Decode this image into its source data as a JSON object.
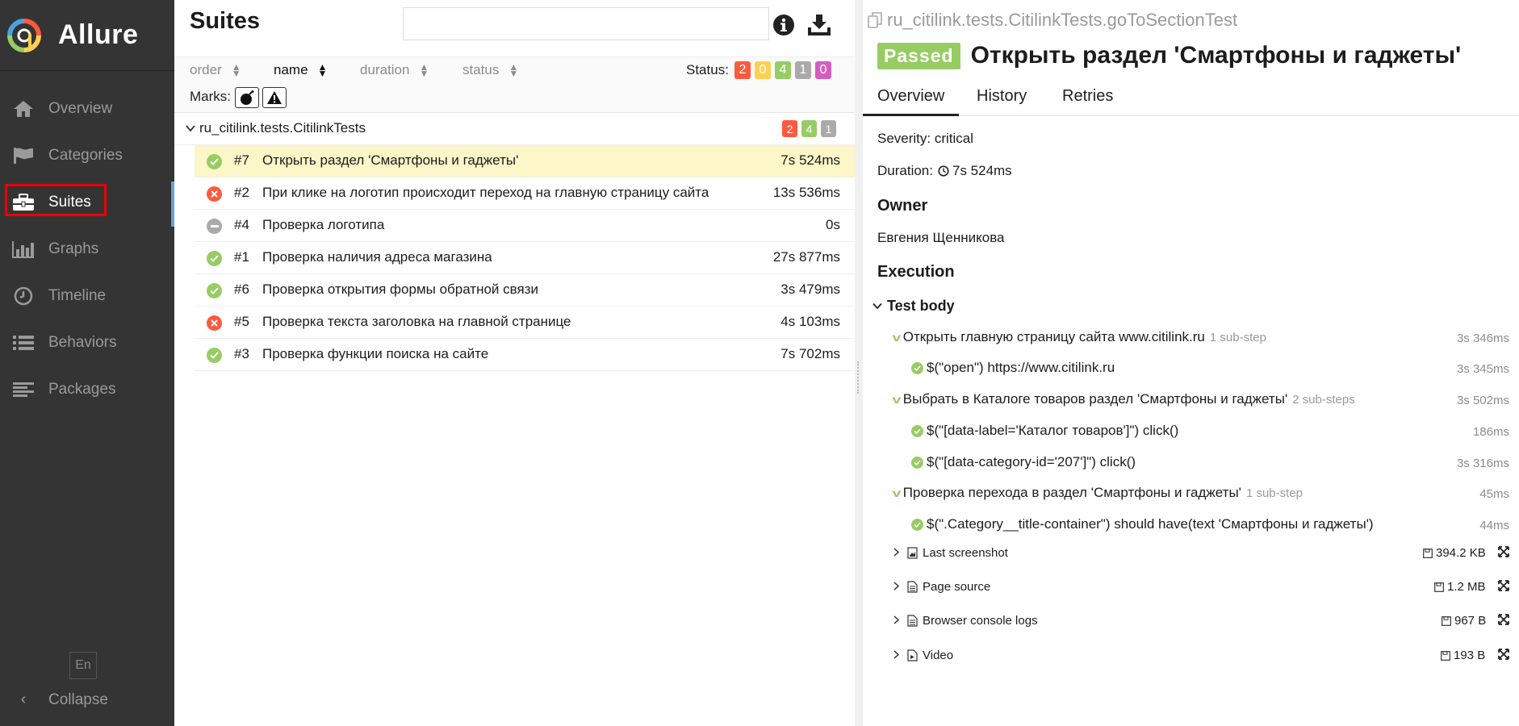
{
  "app": {
    "name": "Allure"
  },
  "sidebar": {
    "items": [
      {
        "label": "Overview",
        "icon": "home-icon"
      },
      {
        "label": "Categories",
        "icon": "flag-icon"
      },
      {
        "label": "Suites",
        "icon": "briefcase-icon"
      },
      {
        "label": "Graphs",
        "icon": "bar-chart-icon"
      },
      {
        "label": "Timeline",
        "icon": "clock-icon"
      },
      {
        "label": "Behaviors",
        "icon": "list-icon"
      },
      {
        "label": "Packages",
        "icon": "align-left-icon"
      }
    ],
    "active": "Suites",
    "lang": "En",
    "collapse": "Collapse"
  },
  "suites": {
    "title": "Suites",
    "search_value": "",
    "sort": {
      "order": "order",
      "name": "name",
      "duration": "duration",
      "status": "status"
    },
    "status_label": "Status:",
    "status_counts": {
      "failed": "2",
      "broken": "0",
      "passed": "4",
      "skipped": "1",
      "unknown": "0"
    },
    "marks_label": "Marks:",
    "group": {
      "name": "ru_citilink.tests.CitilinkTests",
      "counts": {
        "failed": "2",
        "passed": "4",
        "skipped": "1"
      }
    },
    "tests": [
      {
        "num": "#7",
        "name": "Открыть раздел 'Смартфоны и гаджеты'",
        "duration": "7s 524ms",
        "status": "passed"
      },
      {
        "num": "#2",
        "name": "При клике на логотип происходит переход на главную страницу сайта",
        "duration": "13s 536ms",
        "status": "failed"
      },
      {
        "num": "#4",
        "name": "Проверка логотипа",
        "duration": "0s",
        "status": "skipped"
      },
      {
        "num": "#1",
        "name": "Проверка наличия адреса магазина",
        "duration": "27s 877ms",
        "status": "passed"
      },
      {
        "num": "#6",
        "name": "Проверка открытия формы обратной связи",
        "duration": "3s 479ms",
        "status": "passed"
      },
      {
        "num": "#5",
        "name": "Проверка текста заголовка на главной странице",
        "duration": "4s 103ms",
        "status": "failed"
      },
      {
        "num": "#3",
        "name": "Проверка функции поиска на сайте",
        "duration": "7s 702ms",
        "status": "passed"
      }
    ]
  },
  "detail": {
    "fullname": "ru_citilink.tests.CitilinkTests.goToSectionTest",
    "status": "Passed",
    "title": "Открыть раздел 'Смартфоны и гаджеты'",
    "tabs": [
      "Overview",
      "History",
      "Retries"
    ],
    "severity": "Severity: critical",
    "duration_label": "Duration:",
    "duration": "7s 524ms",
    "owner_heading": "Owner",
    "owner": "Евгения Щенникова",
    "execution_heading": "Execution",
    "test_body": "Test body",
    "steps": [
      {
        "name": "Открыть главную страницу сайта www.citilink.ru",
        "sub": "1 sub-step",
        "duration": "3s 346ms",
        "children": [
          {
            "name": "$(\"open\") https://www.citilink.ru",
            "duration": "3s 345ms"
          }
        ]
      },
      {
        "name": "Выбрать в Каталоге товаров раздел 'Смартфоны и гаджеты'",
        "sub": "2 sub-steps",
        "duration": "3s 502ms",
        "children": [
          {
            "name": "$(\"[data-label='Каталог товаров']\") click()",
            "duration": "186ms"
          },
          {
            "name": "$(\"[data-category-id='207']\") click()",
            "duration": "3s 316ms"
          }
        ]
      },
      {
        "name": "Проверка перехода в раздел 'Смартфоны и гаджеты'",
        "sub": "1 sub-step",
        "duration": "45ms",
        "children": [
          {
            "name": "$(\".Category__title-container\") should have(text 'Смартфоны и гаджеты')",
            "duration": "44ms"
          }
        ]
      }
    ],
    "attachments": [
      {
        "name": "Last screenshot",
        "size": "394.2 KB"
      },
      {
        "name": "Page source",
        "size": "1.2 MB"
      },
      {
        "name": "Browser console logs",
        "size": "967 B"
      },
      {
        "name": "Video",
        "size": "193 B"
      }
    ]
  },
  "colors": {
    "failed": "#fd5a3e",
    "broken": "#ffd050",
    "passed": "#97cc64",
    "skipped": "#aaaaaa",
    "unknown": "#d35ebe",
    "sidebar": "#343434",
    "selected_row": "#fcf6c8"
  }
}
